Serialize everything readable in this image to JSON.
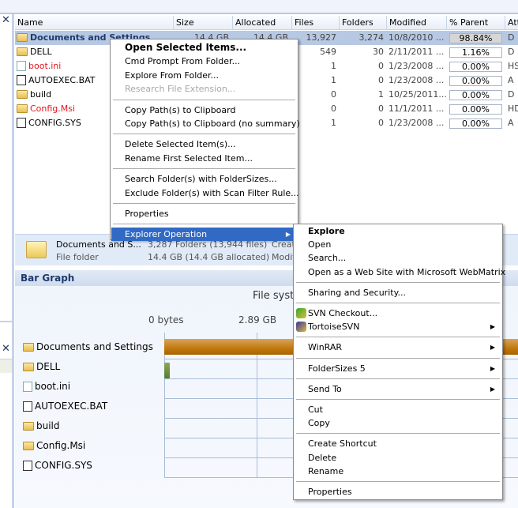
{
  "columns": [
    "Name",
    "Size",
    "Allocated",
    "Files",
    "Folders",
    "Modified",
    "% Parent",
    "Att"
  ],
  "rows": [
    {
      "name": "Documents and Settings",
      "size": "14.4 GB",
      "allocated": "14.4 GB",
      "files": "13,927",
      "folders": "3,274",
      "modified": "10/8/2010 ...",
      "pct": "98.84%",
      "attr": "D",
      "icon": "folder-icon",
      "color": "#1d3a6c"
    },
    {
      "name": "DELL",
      "size": "",
      "allocated": "",
      "files": "549",
      "folders": "30",
      "modified": "2/11/2011 ...",
      "pct": "1.16%",
      "attr": "D",
      "icon": "folder-icon",
      "color": "#000000"
    },
    {
      "name": "boot.ini",
      "size": "",
      "allocated": "",
      "files": "1",
      "folders": "0",
      "modified": "1/23/2008 ...",
      "pct": "0.00%",
      "attr": "HS",
      "icon": "settings-file-icon",
      "color": "#e8141e"
    },
    {
      "name": "AUTOEXEC.BAT",
      "size": "",
      "allocated": "",
      "files": "1",
      "folders": "0",
      "modified": "1/23/2008 ...",
      "pct": "0.00%",
      "attr": "A",
      "icon": "batch-file-icon",
      "color": "#000000"
    },
    {
      "name": "build",
      "size": "",
      "allocated": "",
      "files": "0",
      "folders": "1",
      "modified": "10/25/2011...",
      "pct": "0.00%",
      "attr": "D",
      "icon": "folder-icon",
      "color": "#000000"
    },
    {
      "name": "Config.Msi",
      "size": "",
      "allocated": "",
      "files": "0",
      "folders": "0",
      "modified": "11/1/2011 ...",
      "pct": "0.00%",
      "attr": "HD",
      "icon": "folder-icon",
      "color": "#e8141e"
    },
    {
      "name": "CONFIG.SYS",
      "size": "",
      "allocated": "",
      "files": "1",
      "folders": "0",
      "modified": "1/23/2008 ...",
      "pct": "0.00%",
      "attr": "A",
      "icon": "system-file-icon",
      "color": "#000000"
    }
  ],
  "details": {
    "name": "Documents and S...",
    "type": "File folder",
    "counts": "3,287 Folders (13,944 files)",
    "size": "14.4 GB (14.4 GB allocated)",
    "created": "Creat",
    "modified": "Modif"
  },
  "bar_graph": {
    "title": "Bar Graph",
    "chart_title": "File syst",
    "ticks": [
      "0 bytes",
      "2.89 GB"
    ],
    "items": [
      {
        "name": "Documents and Settings",
        "value_gb": 14.4,
        "icon": "folder-icon"
      },
      {
        "name": "DELL",
        "value_gb": 0.17,
        "icon": "folder-icon"
      },
      {
        "name": "boot.ini",
        "value_gb": 0,
        "icon": "settings-file-icon"
      },
      {
        "name": "AUTOEXEC.BAT",
        "value_gb": 0,
        "icon": "batch-file-icon"
      },
      {
        "name": "build",
        "value_gb": 0,
        "icon": "folder-icon"
      },
      {
        "name": "Config.Msi",
        "value_gb": 0,
        "icon": "folder-icon"
      },
      {
        "name": "CONFIG.SYS",
        "value_gb": 0,
        "icon": "system-file-icon"
      }
    ]
  },
  "context_menu": [
    {
      "label": "Open Selected Items...",
      "bold": true
    },
    {
      "label": "Cmd Prompt From Folder..."
    },
    {
      "label": "Explore From Folder..."
    },
    {
      "label": "Research File Extension...",
      "disabled": true
    },
    {
      "sep": true
    },
    {
      "label": "Copy Path(s) to Clipboard"
    },
    {
      "label": "Copy Path(s) to Clipboard (no summary)"
    },
    {
      "sep": true
    },
    {
      "label": "Delete Selected Item(s)..."
    },
    {
      "label": "Rename First Selected Item..."
    },
    {
      "sep": true
    },
    {
      "label": "Search Folder(s) with FolderSizes..."
    },
    {
      "label": "Exclude Folder(s) with Scan Filter Rule..."
    },
    {
      "sep": true
    },
    {
      "label": "Properties"
    },
    {
      "sep": true
    },
    {
      "label": "Explorer Operation",
      "submenu": true,
      "highlighted": true
    }
  ],
  "submenu": [
    {
      "label": "Explore",
      "bold": true
    },
    {
      "label": "Open"
    },
    {
      "label": "Search..."
    },
    {
      "label": "Open as a Web Site with Microsoft WebMatrix"
    },
    {
      "sep": true
    },
    {
      "label": "Sharing and Security..."
    },
    {
      "sep": true
    },
    {
      "label": "SVN Checkout...",
      "icon": "svn-checkout-icon"
    },
    {
      "label": "TortoiseSVN",
      "submenu": true,
      "icon": "tortoisesvn-icon"
    },
    {
      "sep": true
    },
    {
      "label": "WinRAR",
      "submenu": true
    },
    {
      "sep": true
    },
    {
      "label": "FolderSizes 5",
      "submenu": true
    },
    {
      "sep": true
    },
    {
      "label": "Send To",
      "submenu": true
    },
    {
      "sep": true
    },
    {
      "label": "Cut"
    },
    {
      "label": "Copy"
    },
    {
      "sep": true
    },
    {
      "label": "Create Shortcut"
    },
    {
      "label": "Delete"
    },
    {
      "label": "Rename"
    },
    {
      "sep": true
    },
    {
      "label": "Properties"
    }
  ],
  "colors": {
    "selection": "#b7c8e3",
    "menu_highlight": "#316ac5",
    "bar_main": "#c0780f",
    "bar_small": "#6b8a3a"
  }
}
